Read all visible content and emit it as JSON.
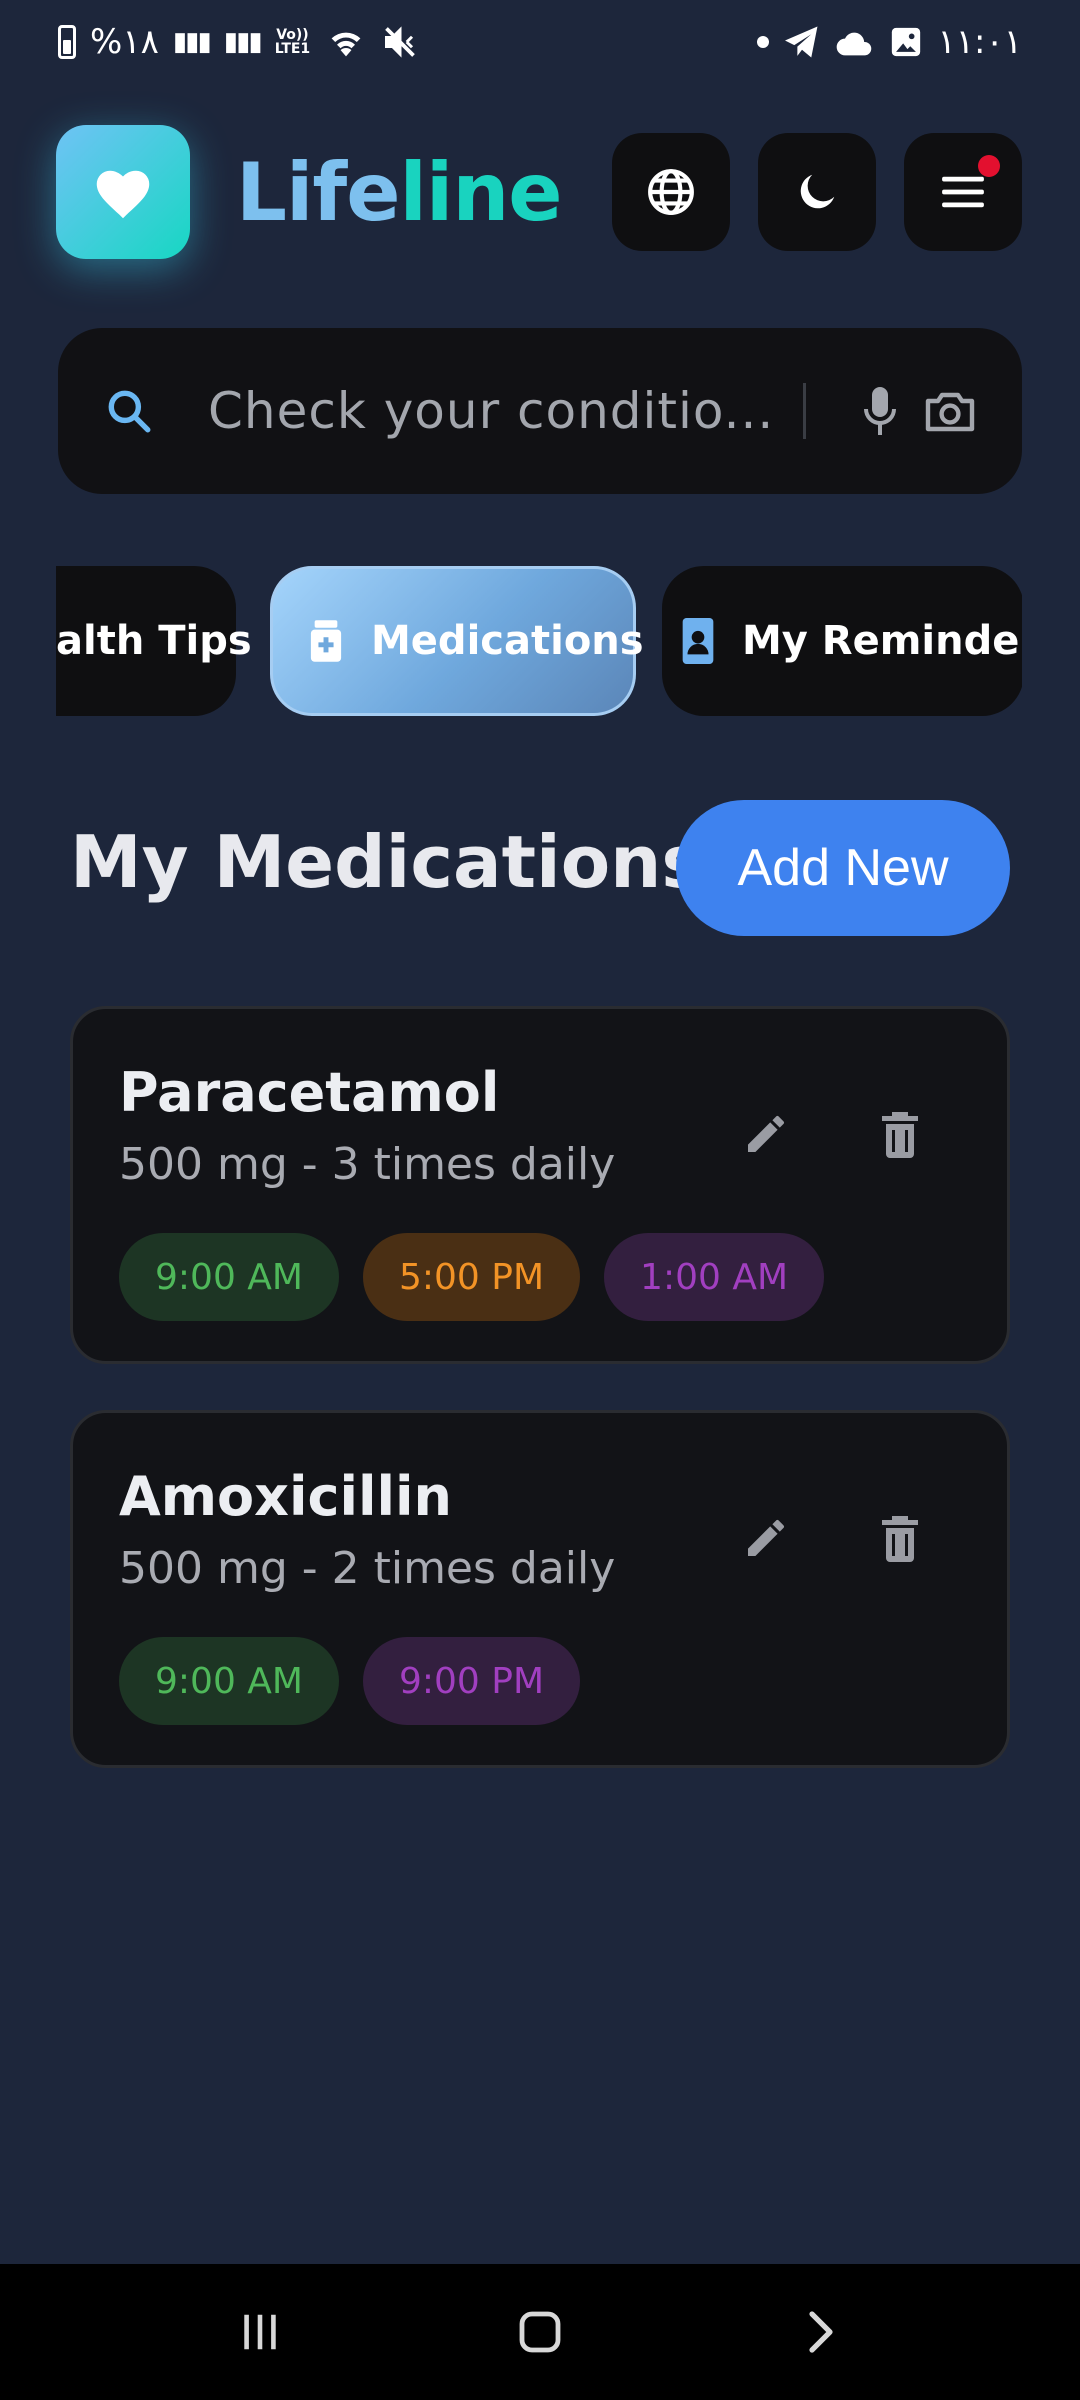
{
  "status_bar": {
    "battery": "%١٨",
    "network": "Vo))\nLTE1",
    "time": "١١:٠١"
  },
  "app": {
    "brand_part1": "Life",
    "brand_part2": "line"
  },
  "search": {
    "placeholder": "Check your conditio..."
  },
  "tabs": [
    {
      "label": "alth Tips"
    },
    {
      "label": "Medications",
      "active": true
    },
    {
      "label": "My Reminders"
    }
  ],
  "section": {
    "title": "My Medications",
    "add_label": "Add New"
  },
  "medications": [
    {
      "name": "Paracetamol",
      "dose": "500 mg - 3 times daily",
      "times": [
        {
          "label": "9:00 AM",
          "color": "green"
        },
        {
          "label": "5:00 PM",
          "color": "orange"
        },
        {
          "label": "1:00 AM",
          "color": "purple"
        }
      ]
    },
    {
      "name": "Amoxicillin",
      "dose": "500 mg - 2 times daily",
      "times": [
        {
          "label": "9:00 AM",
          "color": "green"
        },
        {
          "label": "9:00 PM",
          "color": "purple"
        }
      ]
    }
  ],
  "colors": {
    "background": "#1d263b",
    "accent": "#3e82ef",
    "brand_teal": "#19d3bf",
    "brand_blue": "#7dc0ee",
    "notification": "#e3102f"
  },
  "icons": {
    "logo": "heart-icon",
    "language": "globe-icon",
    "theme": "moon-icon",
    "menu": "menu-icon",
    "search": "search-icon",
    "voice": "microphone-icon",
    "camera": "camera-icon",
    "edit": "pencil-icon",
    "delete": "trash-icon"
  }
}
